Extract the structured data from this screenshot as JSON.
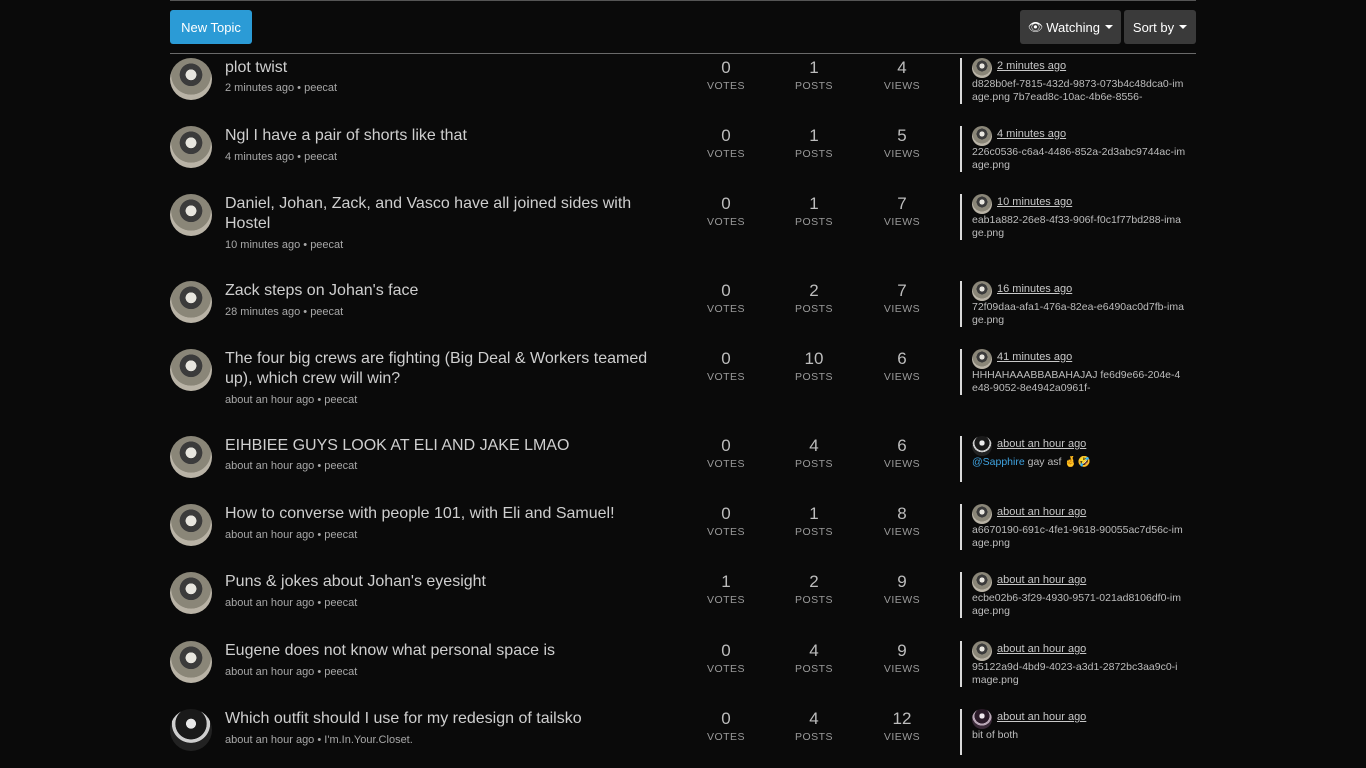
{
  "toolbar": {
    "new_topic_label": "New Topic",
    "watching_label": "Watching",
    "sort_label": "Sort by"
  },
  "stat_labels": {
    "votes": "VOTES",
    "posts": "POSTS",
    "views": "VIEWS"
  },
  "topics": [
    {
      "title": "plot twist",
      "time": "2 minutes ago",
      "author": "peecat",
      "votes": "0",
      "posts": "1",
      "views": "4",
      "last_time": "2 minutes ago",
      "last_text": "d828b0ef-7815-432d-9873-073b4c48dca0-image.png 7b7ead8c-10ac-4b6e-8556-"
    },
    {
      "title": "Ngl I have a pair of shorts like that",
      "time": "4 minutes ago",
      "author": "peecat",
      "votes": "0",
      "posts": "1",
      "views": "5",
      "last_time": "4 minutes ago",
      "last_text": "226c0536-c6a4-4486-852a-2d3abc9744ac-image.png"
    },
    {
      "title": "Daniel, Johan, Zack, and Vasco have all joined sides with Hostel",
      "time": "10 minutes ago",
      "author": "peecat",
      "votes": "0",
      "posts": "1",
      "views": "7",
      "last_time": "10 minutes ago",
      "last_text": "eab1a882-26e8-4f33-906f-f0c1f77bd288-image.png"
    },
    {
      "title": "Zack steps on Johan's face",
      "time": "28 minutes ago",
      "author": "peecat",
      "votes": "0",
      "posts": "2",
      "views": "7",
      "last_time": "16 minutes ago",
      "last_text": "72f09daa-afa1-476a-82ea-e6490ac0d7fb-image.png"
    },
    {
      "title": "The four big crews are fighting (Big Deal & Workers teamed up), which crew will win?",
      "time": "about an hour ago",
      "author": "peecat",
      "votes": "0",
      "posts": "10",
      "views": "6",
      "last_time": "41 minutes ago",
      "last_text": "HHHAHAAABBABAHAJAJ fe6d9e66-204e-4e48-9052-8e4942a0961f-"
    },
    {
      "title": "EIHBIEE GUYS LOOK AT ELI AND JAKE LMAO",
      "time": "about an hour ago",
      "author": "peecat",
      "votes": "0",
      "posts": "4",
      "views": "6",
      "last_time": "about an hour ago",
      "last_mention": "@Sapphire",
      "last_text": " gay asf 🤞🤣"
    },
    {
      "title": "How to converse with people 101, with Eli and Samuel!",
      "time": "about an hour ago",
      "author": "peecat",
      "votes": "0",
      "posts": "1",
      "views": "8",
      "last_time": "about an hour ago",
      "last_text": "a6670190-691c-4fe1-9618-90055ac7d56c-image.png"
    },
    {
      "title": "Puns & jokes about Johan's eyesight",
      "time": "about an hour ago",
      "author": "peecat",
      "votes": "1",
      "posts": "2",
      "views": "9",
      "last_time": "about an hour ago",
      "last_text": "ecbe02b6-3f29-4930-9571-021ad8106df0-image.png"
    },
    {
      "title": "Eugene does not know what personal space is",
      "time": "about an hour ago",
      "author": "peecat",
      "votes": "0",
      "posts": "4",
      "views": "9",
      "last_time": "about an hour ago",
      "last_text": "95122a9d-4bd9-4023-a3d1-2872bc3aa9c0-image.png"
    },
    {
      "title": "Which outfit should I use for my redesign of tailsko",
      "time": "about an hour ago",
      "author": "I'm.In.Your.Closet.",
      "votes": "0",
      "posts": "4",
      "views": "12",
      "last_time": "about an hour ago",
      "last_text": "bit of both"
    }
  ]
}
